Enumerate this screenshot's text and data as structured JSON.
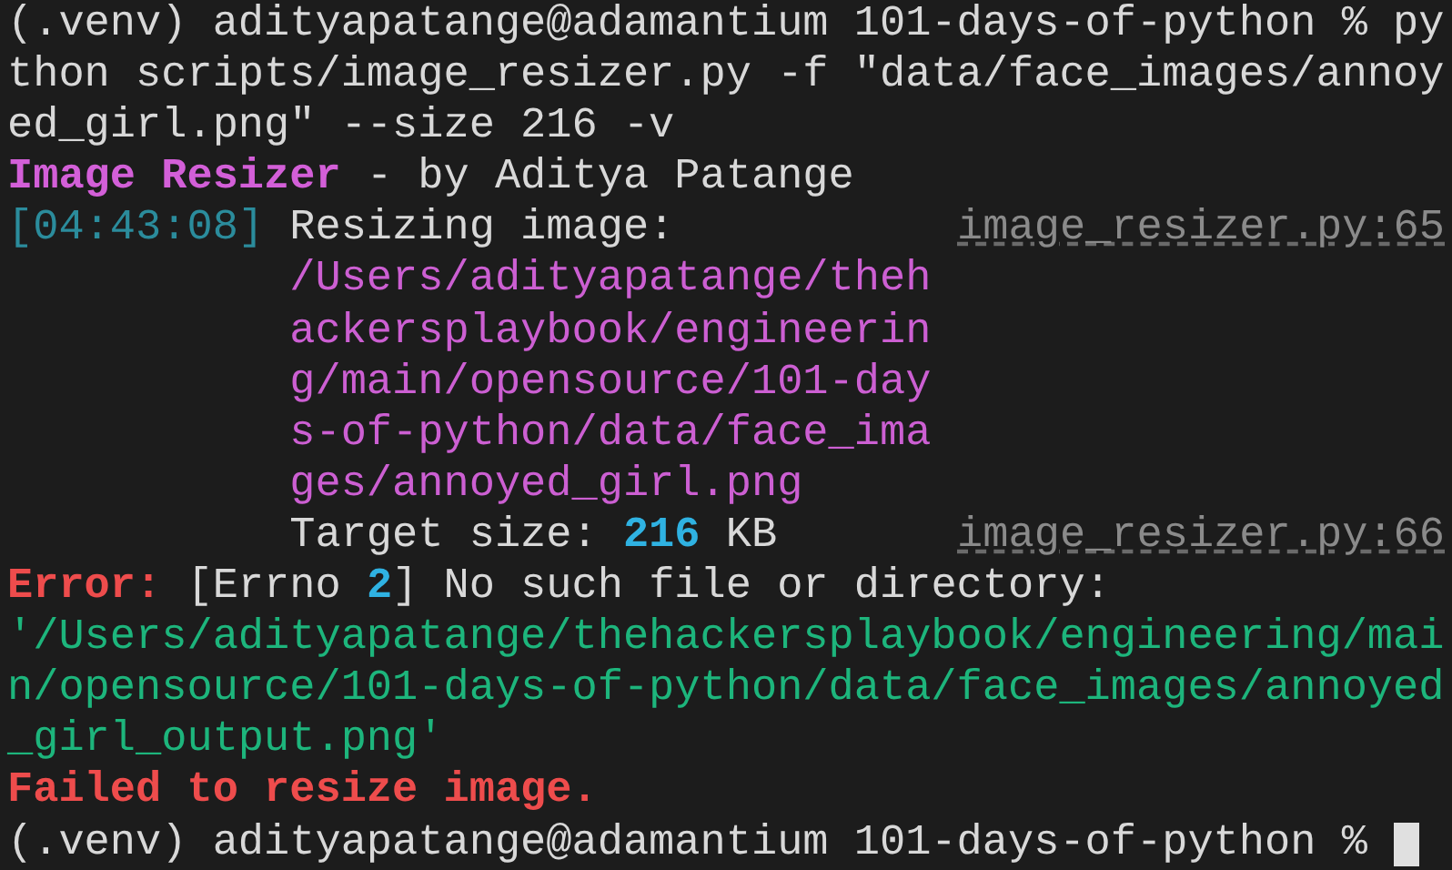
{
  "terminal": {
    "lines": [
      {
        "continuation": false,
        "segments": [
          {
            "text": "(.venv) adityapatange@adamantium 101-days-of-python % py",
            "kind": "plain",
            "space_before": false
          }
        ]
      },
      {
        "continuation": false,
        "segments": [
          {
            "text": "thon scripts/image_resizer.py -f \"data/face_images/annoy",
            "kind": "plain",
            "space_before": false
          }
        ]
      },
      {
        "continuation": false,
        "segments": [
          {
            "text": "ed_girl.png\" --size 216 -v",
            "kind": "plain",
            "space_before": false
          }
        ]
      },
      {
        "continuation": false,
        "segments": [
          {
            "text": "Image Resizer",
            "kind": "heading",
            "space_before": false
          },
          {
            "text": "- by Aditya Patange",
            "kind": "plain",
            "space_before": true
          }
        ]
      },
      {
        "continuation": false,
        "segments": [
          {
            "text": "[04:43:08]",
            "kind": "timestamp",
            "space_before": false
          },
          {
            "text": "Resizing image:",
            "kind": "plain",
            "space_before": true
          }
        ],
        "source": "image_resizer.py:65"
      },
      {
        "continuation": true,
        "segments": [
          {
            "text": "/Users/adityapatange/theh",
            "kind": "path",
            "space_before": false
          }
        ]
      },
      {
        "continuation": true,
        "segments": [
          {
            "text": "ackersplaybook/engineerin",
            "kind": "path",
            "space_before": false
          }
        ]
      },
      {
        "continuation": true,
        "segments": [
          {
            "text": "g/main/opensource/101-day",
            "kind": "path",
            "space_before": false
          }
        ]
      },
      {
        "continuation": true,
        "segments": [
          {
            "text": "s-of-python/data/face_ima",
            "kind": "path",
            "space_before": false
          }
        ]
      },
      {
        "continuation": true,
        "segments": [
          {
            "text": "ges/annoyed_girl.png",
            "kind": "path",
            "space_before": false
          }
        ]
      },
      {
        "continuation": true,
        "segments": [
          {
            "text": "Target size:",
            "kind": "plain",
            "space_before": false
          },
          {
            "text": "216",
            "kind": "number",
            "space_before": true
          },
          {
            "text": "KB",
            "kind": "plain",
            "space_before": true
          }
        ],
        "source": "image_resizer.py:66"
      },
      {
        "continuation": false,
        "segments": [
          {
            "text": "Error:",
            "kind": "error",
            "space_before": false
          },
          {
            "text": "[Errno",
            "kind": "plain",
            "space_before": true
          },
          {
            "text": "2",
            "kind": "number",
            "space_before": true
          },
          {
            "text": "] No such file or directory:",
            "kind": "plain",
            "space_before": false
          }
        ]
      },
      {
        "continuation": false,
        "segments": [
          {
            "text": "'/Users/adityapatange/thehackersplaybook/engineering/mai",
            "kind": "quoted",
            "space_before": false
          }
        ]
      },
      {
        "continuation": false,
        "segments": [
          {
            "text": "n/opensource/101-days-of-python/data/face_images/annoyed",
            "kind": "quoted",
            "space_before": false
          }
        ]
      },
      {
        "continuation": false,
        "segments": [
          {
            "text": "_girl_output.png'",
            "kind": "quoted",
            "space_before": false
          }
        ]
      },
      {
        "continuation": false,
        "segments": [
          {
            "text": "Failed to resize image.",
            "kind": "error",
            "space_before": false
          }
        ]
      },
      {
        "continuation": false,
        "segments": [
          {
            "text": "(.venv) adityapatange@adamantium 101-days-of-python %",
            "kind": "plain",
            "space_before": false
          }
        ],
        "cursor": true
      }
    ]
  }
}
